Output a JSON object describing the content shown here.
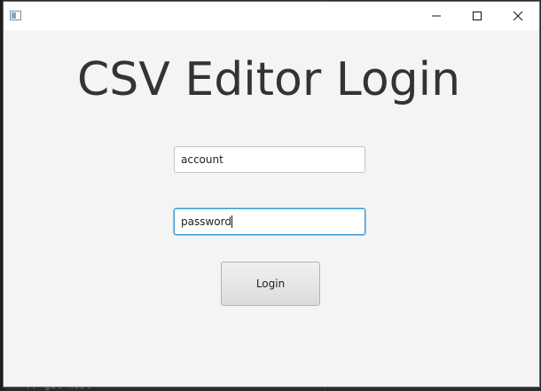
{
  "window": {
    "title": "",
    "app_icon": "app-window-icon",
    "controls": {
      "minimize_icon": "minimize-icon",
      "maximize_icon": "maximize-icon",
      "close_icon": "close-icon"
    }
  },
  "login": {
    "heading": "CSV Editor Login",
    "account_value": "account",
    "password_value": "password",
    "login_label": "Login"
  },
  "background": {
    "code_text": "// get host"
  },
  "colors": {
    "window_bg": "#f4f4f4",
    "focus_border": "#3d98d3",
    "heading_text": "#333333"
  }
}
